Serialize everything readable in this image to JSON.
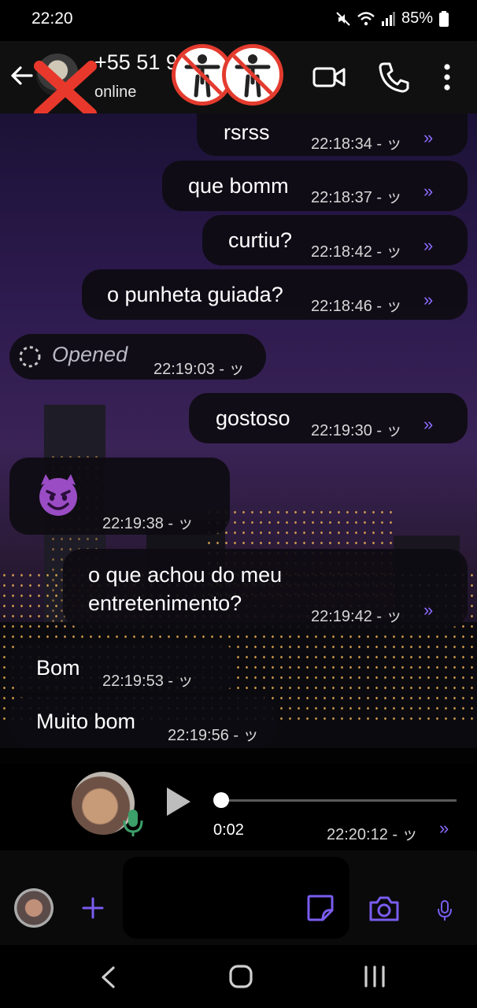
{
  "status_bar": {
    "time": "22:20",
    "battery": "85%",
    "icons": [
      "mute-icon",
      "wifi-icon",
      "signal-icon",
      "battery-icon"
    ]
  },
  "header": {
    "contact_name": "+55 51 9",
    "status": "online",
    "actions": [
      "video-call-icon",
      "phone-icon",
      "more-options-icon"
    ]
  },
  "messages": [
    {
      "side": "out",
      "text": "rsrss",
      "time": "22:18:34 - ッ",
      "status": "read"
    },
    {
      "side": "out",
      "text": "que bomm",
      "time": "22:18:37 - ッ",
      "status": "read"
    },
    {
      "side": "out",
      "text": "curtiu?",
      "time": "22:18:42 - ッ",
      "status": "read"
    },
    {
      "side": "out",
      "text": "o punheta guiada?",
      "time": "22:18:46 - ッ",
      "status": "read"
    },
    {
      "side": "in",
      "text": "Opened",
      "time": "22:19:03 - ッ",
      "kind": "opened-view-once"
    },
    {
      "side": "out",
      "text": "gostoso",
      "time": "22:19:30 - ッ",
      "status": "read"
    },
    {
      "side": "in",
      "text": "😈",
      "time": "22:19:38 - ッ",
      "kind": "emoji"
    },
    {
      "side": "out",
      "text_line1": "o que achou do meu",
      "text_line2": "entretenimento?",
      "time": "22:19:42 - ッ",
      "status": "read"
    },
    {
      "side": "in",
      "text": "Bom",
      "time": "22:19:53 - ッ"
    },
    {
      "side": "in",
      "text": "Muito bom",
      "time": "22:19:56 - ッ"
    },
    {
      "side": "out",
      "kind": "voice",
      "duration": "0:02",
      "progress": 0,
      "time": "22:20:12 - ッ",
      "status": "read"
    }
  ],
  "read_tick": "»",
  "colors": {
    "accent": "#8b6cff",
    "bubble": "#0e0c12",
    "blocker_ring": "#e33b2e"
  },
  "input_bar": {
    "icons": [
      "avatar",
      "add-icon",
      "sticker-icon",
      "camera-icon",
      "mic-icon"
    ]
  },
  "nav_bar": {
    "icons": [
      "back-nav-icon",
      "home-nav-icon",
      "recents-nav-icon"
    ]
  }
}
